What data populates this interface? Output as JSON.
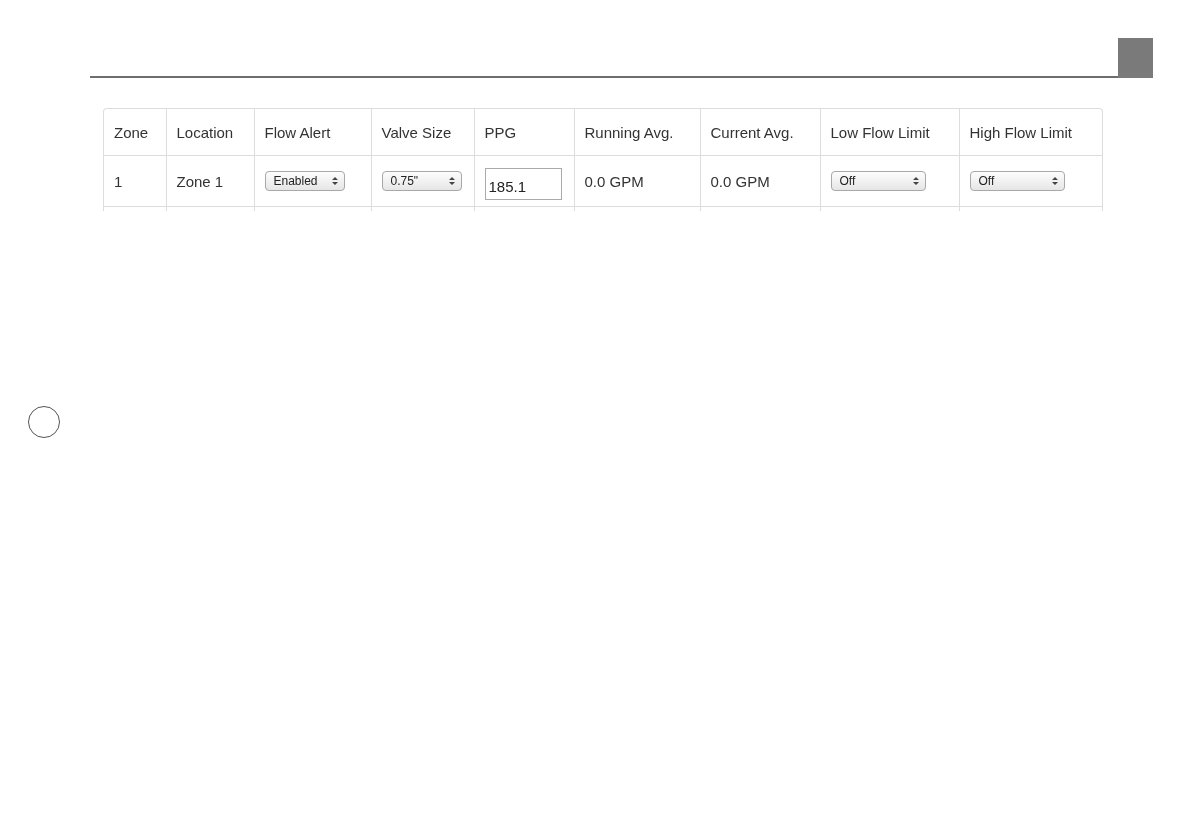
{
  "table": {
    "columns": [
      "Zone",
      "Location",
      "Flow Alert",
      "Valve Size",
      "PPG",
      "Running Avg.",
      "Current Avg.",
      "Low Flow Limit",
      "High Flow Limit"
    ],
    "rows": [
      {
        "cells": [
          {
            "kind": "text",
            "value": "1"
          },
          {
            "kind": "text",
            "value": "Zone 1"
          },
          {
            "kind": "select",
            "value": "Enabled"
          },
          {
            "kind": "select",
            "value": "0.75\""
          },
          {
            "kind": "input",
            "value": "185.1"
          },
          {
            "kind": "text",
            "value": "0.0 GPM"
          },
          {
            "kind": "text",
            "value": "0.0 GPM"
          },
          {
            "kind": "select",
            "value": "Off"
          },
          {
            "kind": "select",
            "value": "Off"
          }
        ]
      }
    ]
  }
}
